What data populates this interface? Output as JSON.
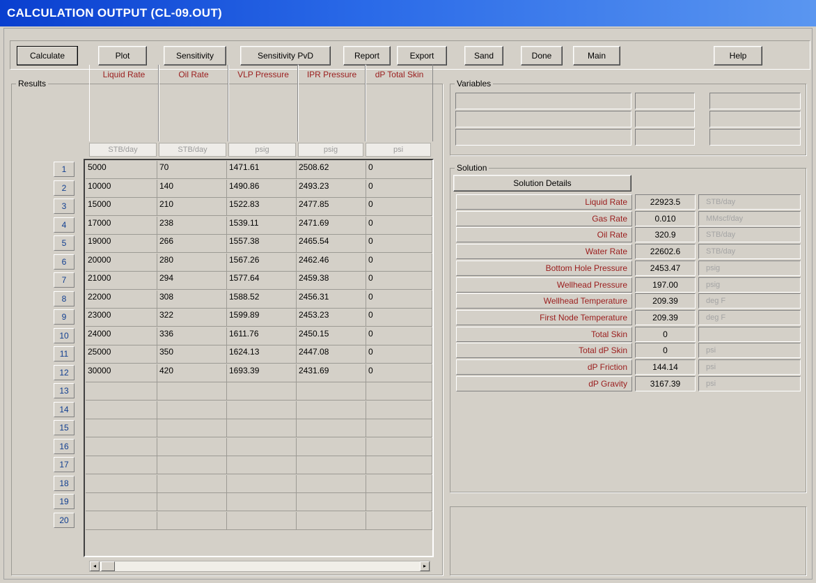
{
  "window": {
    "title": "CALCULATION OUTPUT (CL-09.OUT)"
  },
  "toolbar": {
    "buttons": [
      "Calculate",
      "Plot",
      "Sensitivity",
      "Sensitivity PvD",
      "Report",
      "Export",
      "Sand",
      "Done",
      "Main",
      "Help"
    ]
  },
  "results": {
    "label": "Results",
    "columns": [
      {
        "header": "Liquid Rate",
        "unit": "STB/day"
      },
      {
        "header": "Oil Rate",
        "unit": "STB/day"
      },
      {
        "header": "VLP Pressure",
        "unit": "psig"
      },
      {
        "header": "IPR Pressure",
        "unit": "psig"
      },
      {
        "header": "dP Total Skin",
        "unit": "psi"
      }
    ],
    "row_numbers": [
      "1",
      "2",
      "3",
      "4",
      "5",
      "6",
      "7",
      "8",
      "9",
      "10",
      "11",
      "12",
      "13",
      "14",
      "15",
      "16",
      "17",
      "18",
      "19",
      "20"
    ],
    "rows": [
      [
        "5000",
        "70",
        "1471.61",
        "2508.62",
        "0"
      ],
      [
        "10000",
        "140",
        "1490.86",
        "2493.23",
        "0"
      ],
      [
        "15000",
        "210",
        "1522.83",
        "2477.85",
        "0"
      ],
      [
        "17000",
        "238",
        "1539.11",
        "2471.69",
        "0"
      ],
      [
        "19000",
        "266",
        "1557.38",
        "2465.54",
        "0"
      ],
      [
        "20000",
        "280",
        "1567.26",
        "2462.46",
        "0"
      ],
      [
        "21000",
        "294",
        "1577.64",
        "2459.38",
        "0"
      ],
      [
        "22000",
        "308",
        "1588.52",
        "2456.31",
        "0"
      ],
      [
        "23000",
        "322",
        "1599.89",
        "2453.23",
        "0"
      ],
      [
        "24000",
        "336",
        "1611.76",
        "2450.15",
        "0"
      ],
      [
        "25000",
        "350",
        "1624.13",
        "2447.08",
        "0"
      ],
      [
        "30000",
        "420",
        "1693.39",
        "2431.69",
        "0"
      ]
    ]
  },
  "variables": {
    "label": "Variables"
  },
  "solution": {
    "label": "Solution",
    "details_button": "Solution Details",
    "items": [
      {
        "label": "Liquid Rate",
        "value": "22923.5",
        "unit": "STB/day"
      },
      {
        "label": "Gas Rate",
        "value": "0.010",
        "unit": "MMscf/day"
      },
      {
        "label": "Oil Rate",
        "value": "320.9",
        "unit": "STB/day"
      },
      {
        "label": "Water Rate",
        "value": "22602.6",
        "unit": "STB/day"
      },
      {
        "label": "Bottom Hole Pressure",
        "value": "2453.47",
        "unit": "psig"
      },
      {
        "label": "Wellhead Pressure",
        "value": "197.00",
        "unit": "psig"
      },
      {
        "label": "Wellhead Temperature",
        "value": "209.39",
        "unit": "deg F"
      },
      {
        "label": "First Node Temperature",
        "value": "209.39",
        "unit": "deg F"
      },
      {
        "label": "Total Skin",
        "value": "0",
        "unit": ""
      },
      {
        "label": "Total dP Skin",
        "value": "0",
        "unit": "psi"
      },
      {
        "label": "dP Friction",
        "value": "144.14",
        "unit": "psi"
      },
      {
        "label": "dP Gravity",
        "value": "3167.39",
        "unit": "psi"
      }
    ]
  }
}
